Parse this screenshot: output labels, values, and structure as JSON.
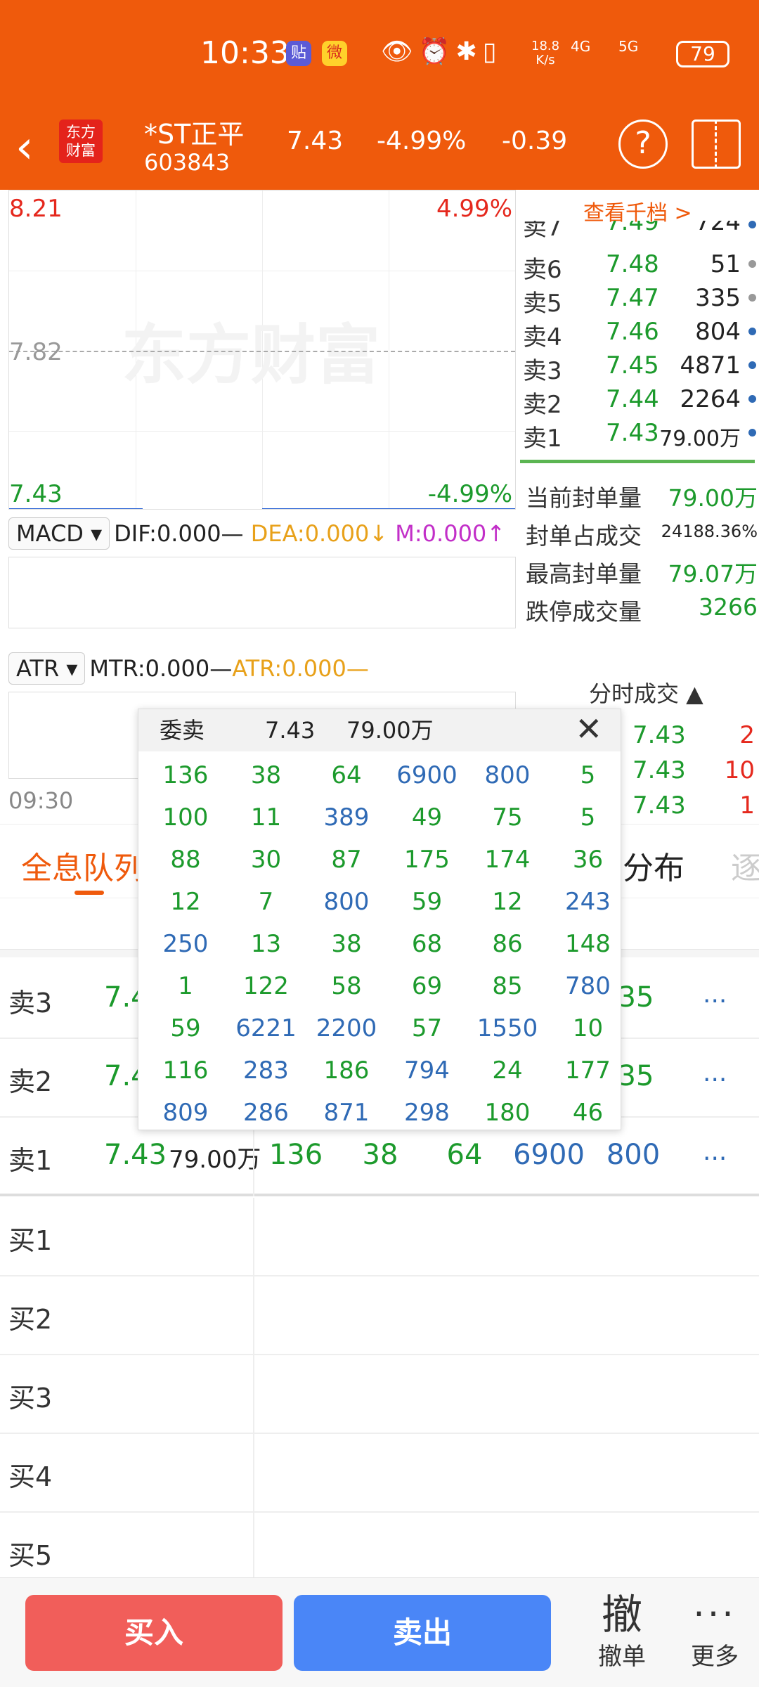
{
  "status_bar": {
    "time": "10:33",
    "net_speed": "18.8",
    "net_unit": "K/s",
    "sig1": "4G",
    "sig2": "5G",
    "battery": "79"
  },
  "header": {
    "logo_line1": "东方",
    "logo_line2": "财富",
    "stock_name": "*ST正平",
    "stock_code": "603843",
    "price": "7.43",
    "change_pct": "-4.99%",
    "change": "-0.39"
  },
  "chart": {
    "upper_price": "8.21",
    "upper_pct": "4.99%",
    "mid_price": "7.82",
    "lower_price": "7.43",
    "lower_pct": "-4.99%",
    "watermark": "东方财富",
    "time_start": "09:30"
  },
  "macd": {
    "selector": "MACD",
    "dif": "DIF:0.000—",
    "dea": "DEA:0.000↓",
    "m": "M:0.000↑"
  },
  "atr": {
    "selector": "ATR",
    "mtr": "MTR:0.000—",
    "atr": "ATR:0.000—"
  },
  "order_book": {
    "view_more": "查看千档 >",
    "asks": [
      {
        "label": "卖7",
        "price": "7.49",
        "vol": "724"
      },
      {
        "label": "卖6",
        "price": "7.48",
        "vol": "51"
      },
      {
        "label": "卖5",
        "price": "7.47",
        "vol": "335"
      },
      {
        "label": "卖4",
        "price": "7.46",
        "vol": "804"
      },
      {
        "label": "卖3",
        "price": "7.45",
        "vol": "4871"
      },
      {
        "label": "卖2",
        "price": "7.44",
        "vol": "2264"
      },
      {
        "label": "卖1",
        "price": "7.43",
        "vol": "79.00万"
      }
    ],
    "stats": [
      {
        "key": "当前封单量",
        "value": "79.00万"
      },
      {
        "key": "封单占成交",
        "value": "24188.36%"
      },
      {
        "key": "最高封单量",
        "value": "79.07万"
      },
      {
        "key": "跌停成交量",
        "value": "3266"
      }
    ]
  },
  "ticks": {
    "header": "分时成交 ▲",
    "rows": [
      {
        "price": "7.43",
        "vol": "2"
      },
      {
        "price": "7.43",
        "vol": "10"
      },
      {
        "price": "7.43",
        "vol": "1"
      }
    ]
  },
  "tabs": {
    "active": "全息队列",
    "distribution": "分布",
    "next": "逐"
  },
  "queue": {
    "rows": [
      {
        "label": "卖3",
        "price": "7.4",
        "extra": "35",
        "more": "..."
      },
      {
        "label": "卖2",
        "price": "7.4",
        "extra": "35",
        "more": "..."
      },
      {
        "label": "卖1",
        "price": "7.43",
        "vol": "79.00万",
        "orders": [
          "136",
          "38",
          "64",
          "6900",
          "800"
        ],
        "more": "..."
      },
      {
        "label": "买1"
      },
      {
        "label": "买2"
      },
      {
        "label": "买3"
      },
      {
        "label": "买4"
      },
      {
        "label": "买5"
      }
    ]
  },
  "popup": {
    "title": "委卖",
    "price": "7.43",
    "volume": "79.00万",
    "grid": [
      [
        "136",
        "38",
        "64",
        "6900",
        "800",
        "5"
      ],
      [
        "100",
        "11",
        "389",
        "49",
        "75",
        "5"
      ],
      [
        "88",
        "30",
        "87",
        "175",
        "174",
        "36"
      ],
      [
        "12",
        "7",
        "800",
        "59",
        "12",
        "243"
      ],
      [
        "250",
        "13",
        "38",
        "68",
        "86",
        "148"
      ],
      [
        "1",
        "122",
        "58",
        "69",
        "85",
        "780"
      ],
      [
        "59",
        "6221",
        "2200",
        "57",
        "1550",
        "10"
      ],
      [
        "116",
        "283",
        "186",
        "794",
        "24",
        "177"
      ],
      [
        "809",
        "286",
        "871",
        "298",
        "180",
        "46"
      ]
    ]
  },
  "bottom": {
    "buy": "买入",
    "sell": "卖出",
    "cancel_glyph": "撤",
    "cancel": "撤单",
    "more": "更多"
  },
  "colors": {
    "brand": "#ef5a0c",
    "up": "#e5281d",
    "down": "#1c9a2c",
    "big_order": "#2f6ab5"
  }
}
